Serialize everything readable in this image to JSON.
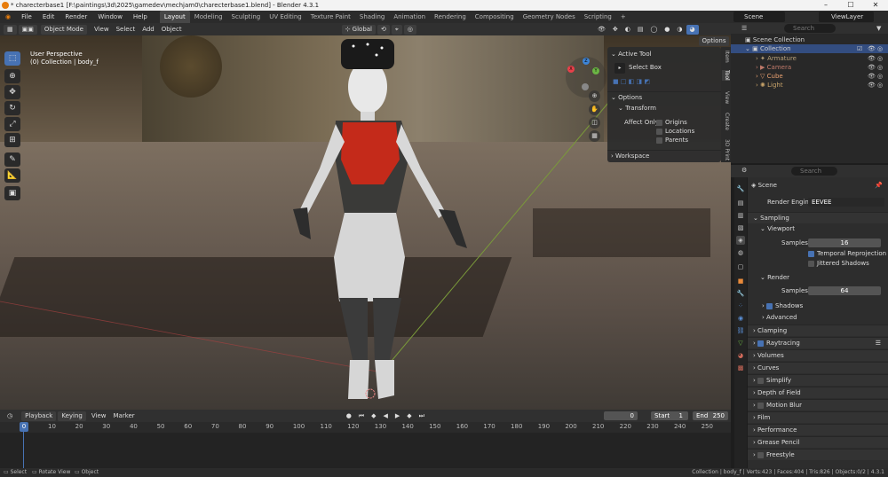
{
  "window": {
    "title": "* charecterbase1 [F:\\paintings\\3d\\2025\\gamedev\\mechjam0\\charecterbase1.blend] - Blender 4.3.1"
  },
  "menus": [
    "File",
    "Edit",
    "Render",
    "Window",
    "Help"
  ],
  "workspaces": [
    "Layout",
    "Modeling",
    "Sculpting",
    "UV Editing",
    "Texture Paint",
    "Shading",
    "Animation",
    "Rendering",
    "Compositing",
    "Geometry Nodes",
    "Scripting"
  ],
  "active_workspace": "Layout",
  "scene_selector": "Scene",
  "viewlayer_selector": "ViewLayer",
  "viewport_header": {
    "mode": "Object Mode",
    "menus": [
      "View",
      "Select",
      "Add",
      "Object"
    ],
    "transform_orientation": "Global",
    "options": "Options"
  },
  "viewport": {
    "perspective": "User Perspective",
    "collection": "(0) Collection | body_f",
    "gizmo": {
      "x": "X",
      "y": "Y",
      "z": "Z"
    }
  },
  "npanel": {
    "active_tool_title": "Active Tool",
    "tool_name": "Select Box",
    "options_title": "Options",
    "transform_title": "Transform",
    "affect_only": "Affect Only",
    "origins": "Origins",
    "locations": "Locations",
    "parents": "Parents",
    "workspace": "Workspace",
    "tabs": [
      "Item",
      "Tool",
      "View",
      "Create",
      "3D Print"
    ]
  },
  "timeline": {
    "menus": [
      "Playback",
      "Keying",
      "View",
      "Marker"
    ],
    "current_frame": "0",
    "start_label": "Start",
    "start": "1",
    "end_label": "End",
    "end": "250",
    "ruler": [
      "10",
      "20",
      "30",
      "40",
      "50",
      "60",
      "70",
      "80",
      "90",
      "100",
      "110",
      "120",
      "130",
      "140",
      "150",
      "160",
      "170",
      "180",
      "190",
      "200",
      "210",
      "220",
      "230",
      "240",
      "250"
    ],
    "cursor": "0"
  },
  "status": {
    "select": "Select",
    "rotate": "Rotate View",
    "object": "Object",
    "stats": "Collection | body_f | Verts:423 | Faces:404 | Tris:826 | Objects:0/2 | 4.3.1"
  },
  "outliner": {
    "search_placeholder": "Search",
    "scene_collection": "Scene Collection",
    "collection": "Collection",
    "items": [
      "Armature",
      "Camera",
      "Cube",
      "Light"
    ]
  },
  "properties": {
    "search_placeholder": "Search",
    "scene": "Scene",
    "render_engine_label": "Render Engine",
    "render_engine": "EEVEE",
    "sampling": "Sampling",
    "viewport": "Viewport",
    "samples_label": "Samples",
    "viewport_samples": "16",
    "temporal_reprojection": "Temporal Reprojection",
    "jittered_shadows": "Jittered Shadows",
    "render": "Render",
    "render_samples": "64",
    "shadows": "Shadows",
    "advanced": "Advanced",
    "sections": [
      "Clamping",
      "Raytracing",
      "Volumes",
      "Curves",
      "Simplify",
      "Depth of Field",
      "Motion Blur",
      "Film",
      "Performance",
      "Grease Pencil",
      "Freestyle"
    ]
  },
  "colors": {
    "accent": "#4772b3",
    "x_axis": "#e8404a",
    "y_axis": "#6bb544",
    "z_axis": "#3d84d6"
  }
}
